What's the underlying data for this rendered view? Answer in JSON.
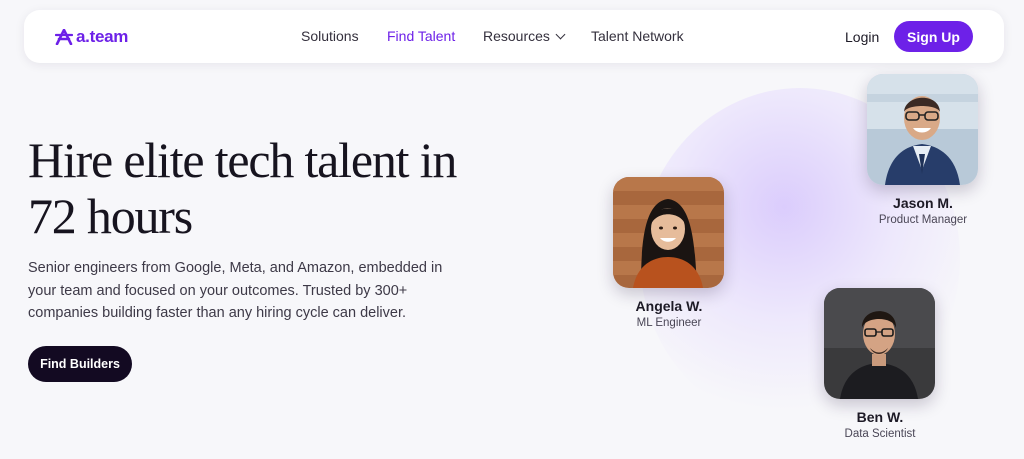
{
  "nav": {
    "logo_text": "a.team",
    "links": [
      "Solutions",
      "Find Talent",
      "Resources",
      "Talent Network"
    ],
    "login": "Login",
    "signup": "Sign Up"
  },
  "hero": {
    "title_line1": "Hire elite tech talent in",
    "title_line2": "72 hours",
    "subtitle": "Senior engineers from Google, Meta, and Amazon, embedded in your team and focused on your outcomes. Trusted by 300+ companies building faster than any hiring cycle can deliver.",
    "cta": "Find Builders"
  },
  "profiles": [
    {
      "name": "Jason M.",
      "role": "Product Manager"
    },
    {
      "name": "Angela W.",
      "role": "ML Engineer"
    },
    {
      "name": "Ben W.",
      "role": "Data Scientist"
    }
  ],
  "colors": {
    "brand": "#6d21e8",
    "cta_bg": "#130a22",
    "page_bg": "#f7f7fa"
  }
}
